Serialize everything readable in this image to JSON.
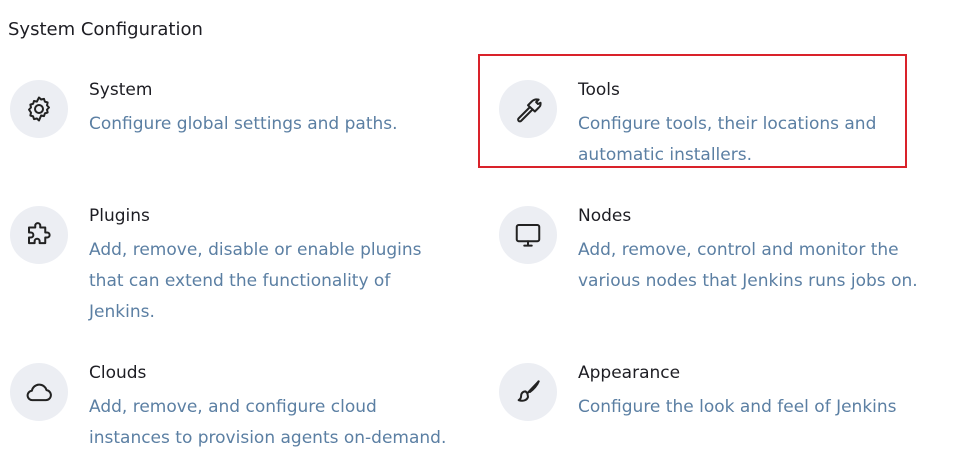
{
  "section": {
    "title": "System Configuration"
  },
  "items": [
    {
      "title": "System",
      "description": "Configure global settings and paths.",
      "icon": "gear-icon"
    },
    {
      "title": "Tools",
      "description": "Configure tools, their locations and automatic installers.",
      "icon": "hammer-icon"
    },
    {
      "title": "Plugins",
      "description": "Add, remove, disable or enable plugins that can extend the functionality of Jenkins.",
      "icon": "puzzle-icon"
    },
    {
      "title": "Nodes",
      "description": "Add, remove, control and monitor the various nodes that Jenkins runs jobs on.",
      "icon": "monitor-icon"
    },
    {
      "title": "Clouds",
      "description": "Add, remove, and configure cloud instances to provision agents on-demand.",
      "icon": "cloud-icon"
    },
    {
      "title": "Appearance",
      "description": "Configure the look and feel of Jenkins",
      "icon": "paintbrush-icon"
    }
  ],
  "colors": {
    "title_text": "#1d1d23",
    "description_text": "#5b7fa3",
    "icon_background": "#eceef3",
    "highlight_border": "#d9222a"
  }
}
